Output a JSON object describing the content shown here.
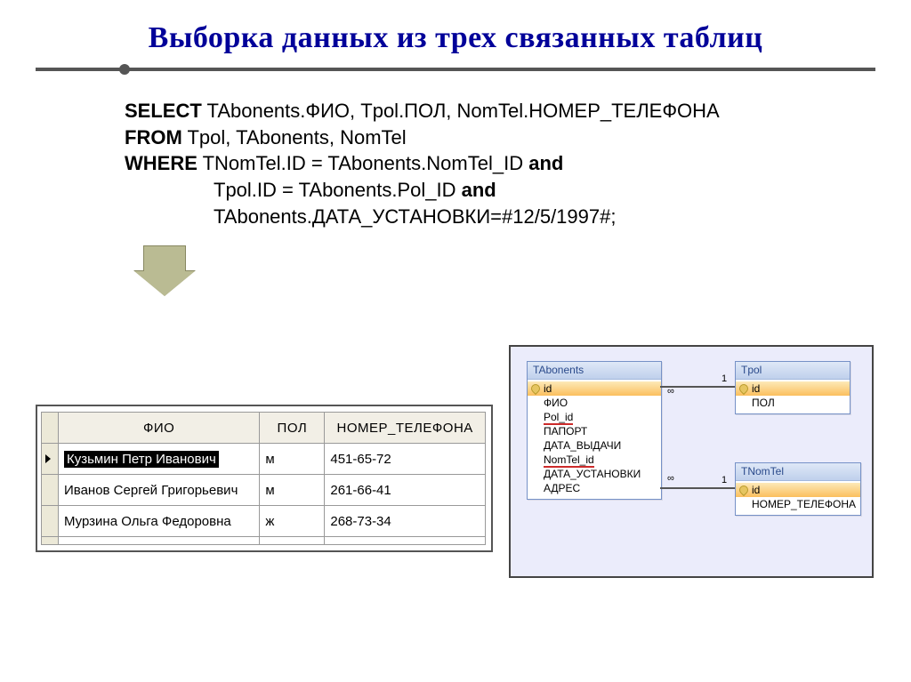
{
  "title": "Выборка данных из трех связанных таблиц",
  "sql": {
    "select_kw": "SELECT",
    "select_fields": " TAbonents.ФИО, Tpol.ПОЛ, NomTel.НОМЕР_ТЕЛЕФОНА",
    "from_kw": "FROM",
    "from_tables": " Tpol, TAbonents, NomTel",
    "where_kw": "WHERE",
    "where_line1_a": " TNomTel.ID = TAbonents.NomTel_ID ",
    "and_kw": "and",
    "where_line2": "Tpol.ID = TAbonents.Pol_ID ",
    "where_line3": "TAbonents.ДАТА_УСТАНОВКИ=#12/5/1997#;"
  },
  "results": {
    "headers": [
      "ФИО",
      "ПОЛ",
      "НОМЕР_ТЕЛЕФОНА"
    ],
    "rows": [
      {
        "fio": "Кузьмин Петр Иванович",
        "pol": "м",
        "tel": "451-65-72",
        "selected": true
      },
      {
        "fio": "Иванов Сергей Григорьевич",
        "pol": "м",
        "tel": "261-66-41",
        "selected": false
      },
      {
        "fio": "Мурзина Ольга Федоровна",
        "pol": "ж",
        "tel": "268-73-34",
        "selected": false
      }
    ]
  },
  "diagram": {
    "tabonents": {
      "title": "TAbonents",
      "fields": [
        "id",
        "ФИО",
        "Pol_id",
        "ПАПОРТ",
        "ДАТА_ВЫДАЧИ",
        "NomTel_id",
        "ДАТА_УСТАНОВКИ",
        "АДРЕС"
      ]
    },
    "tpol": {
      "title": "Tpol",
      "fields": [
        "id",
        "ПОЛ"
      ]
    },
    "tnomtel": {
      "title": "TNomTel",
      "fields": [
        "id",
        "НОМЕР_ТЕЛЕФОНА"
      ]
    },
    "card": {
      "one": "1",
      "many": "∞"
    }
  }
}
